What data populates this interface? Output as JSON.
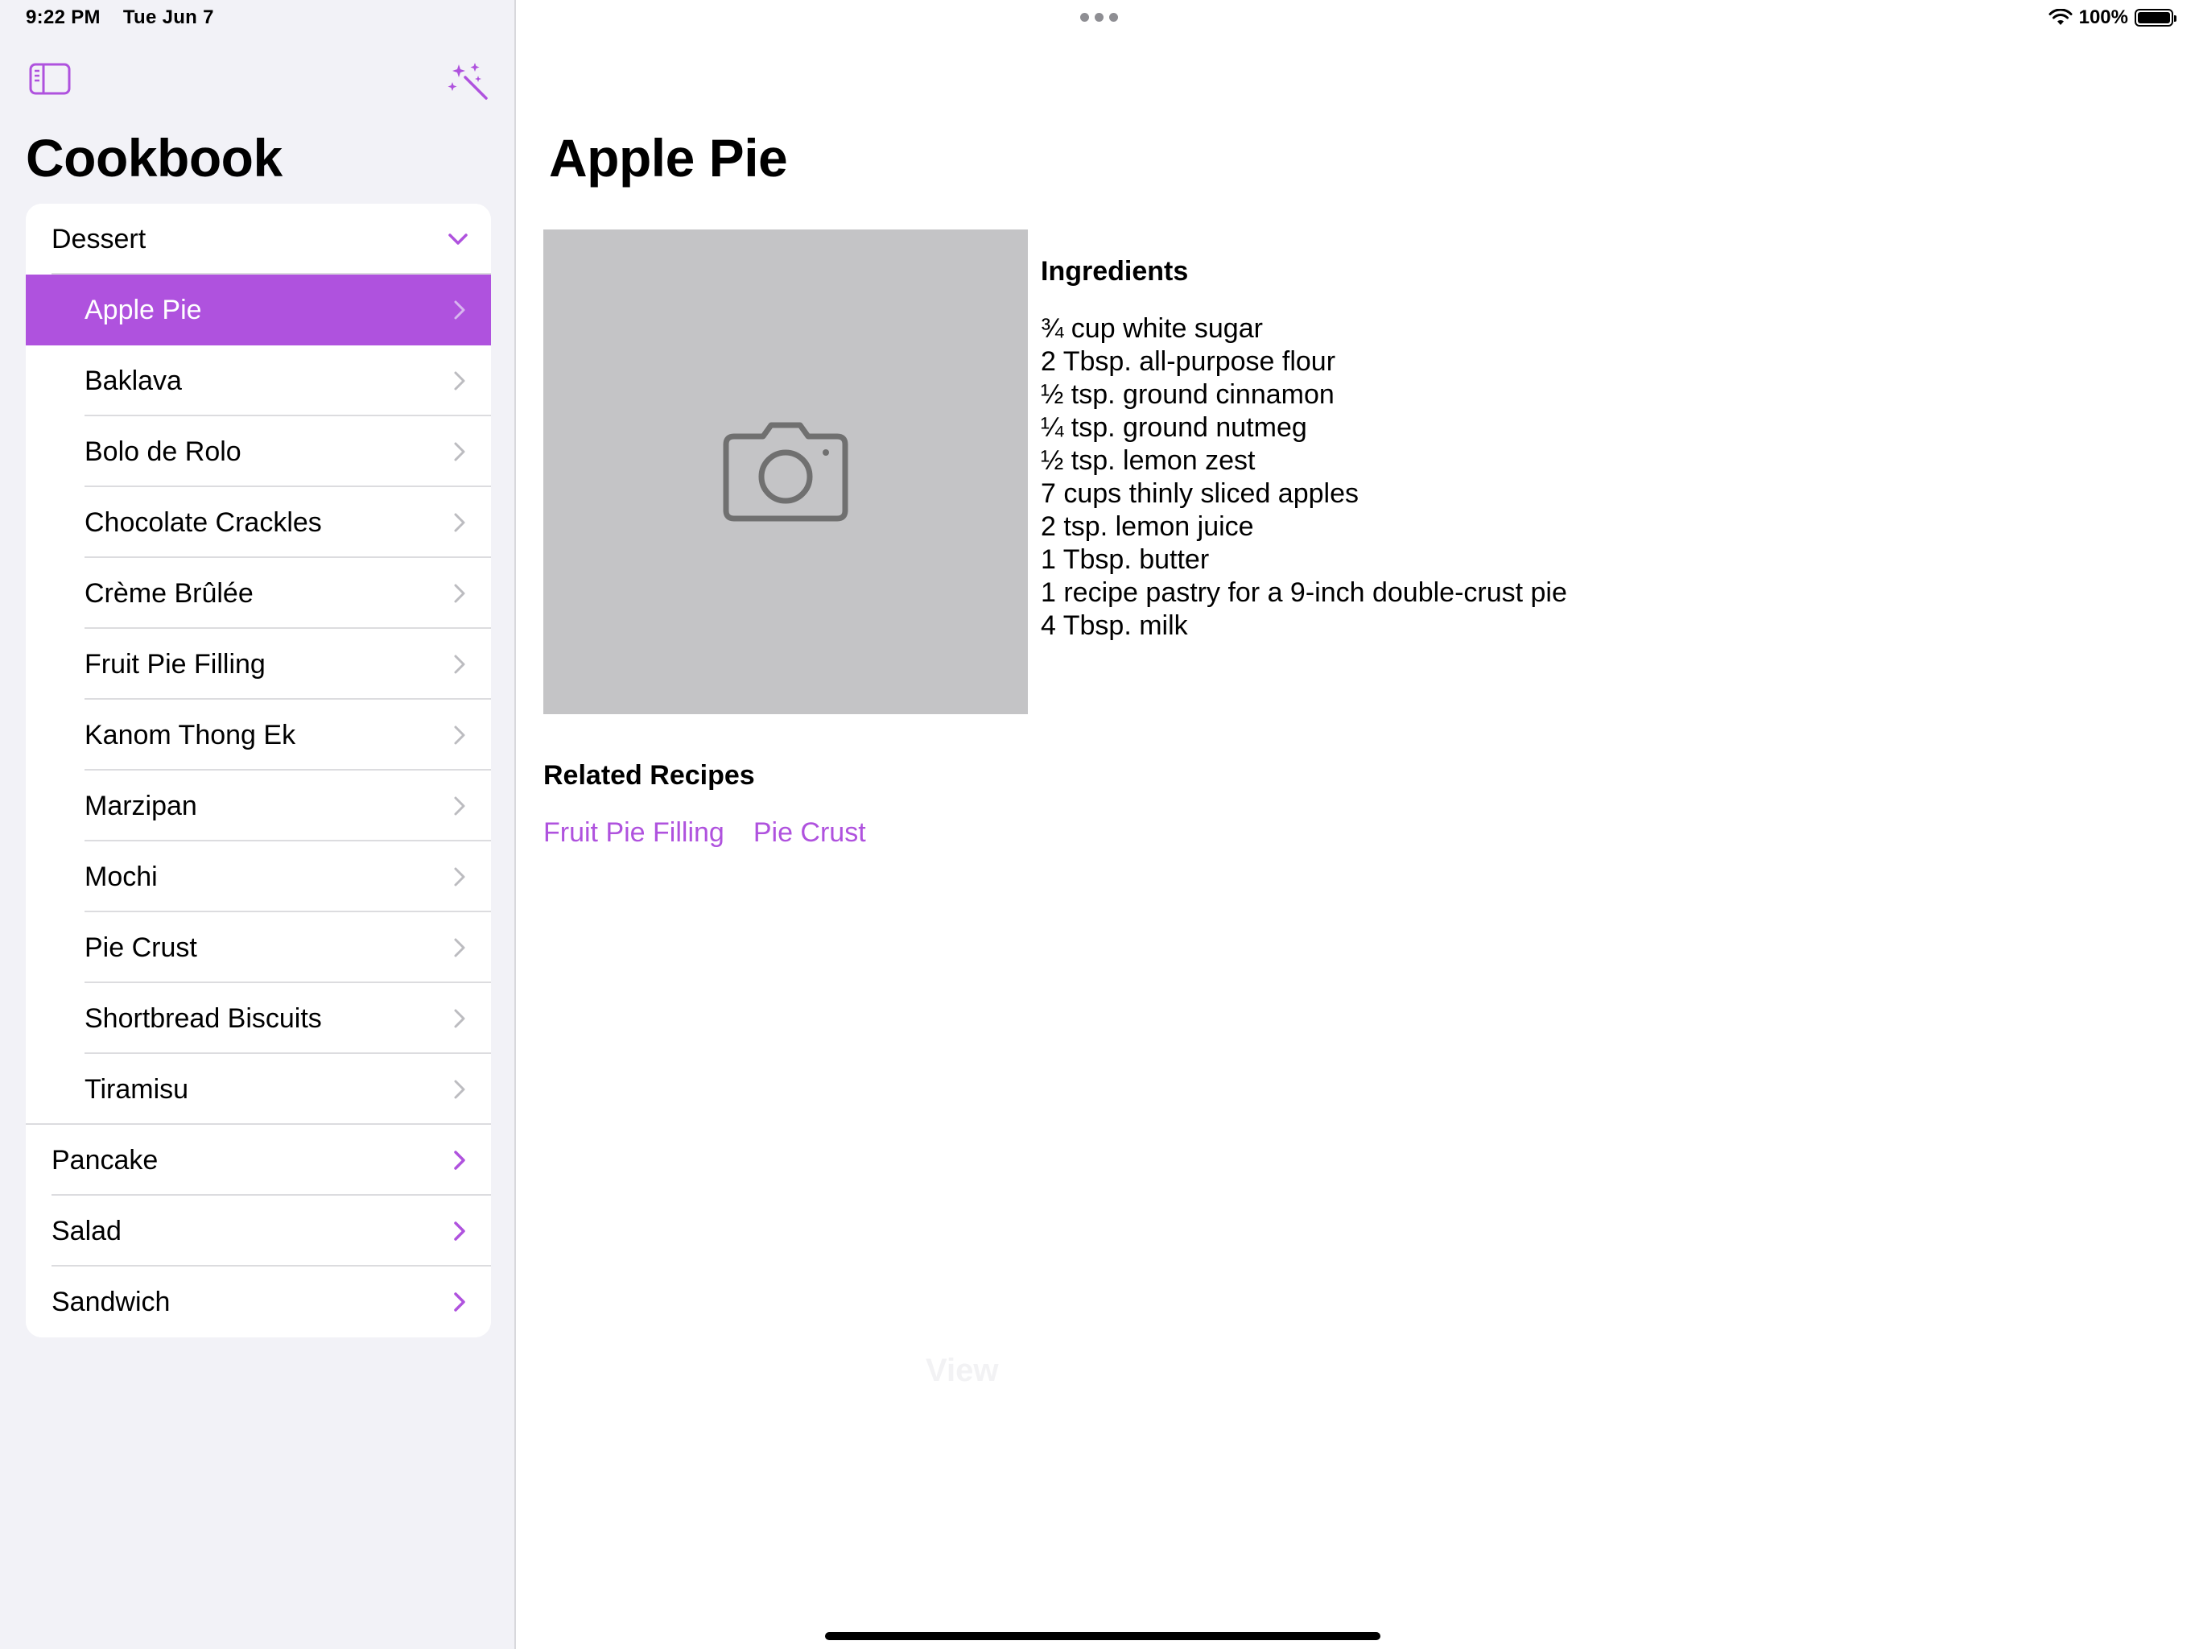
{
  "status_bar": {
    "time": "9:22 PM",
    "date": "Tue Jun 7",
    "battery": "100%"
  },
  "sidebar": {
    "title": "Cookbook",
    "groups": [
      {
        "label": "Dessert",
        "expanded": true,
        "items": [
          {
            "label": "Apple Pie",
            "selected": true
          },
          {
            "label": "Baklava"
          },
          {
            "label": "Bolo de Rolo"
          },
          {
            "label": "Chocolate Crackles"
          },
          {
            "label": "Crème Brûlée"
          },
          {
            "label": "Fruit Pie Filling"
          },
          {
            "label": "Kanom Thong Ek"
          },
          {
            "label": "Marzipan"
          },
          {
            "label": "Mochi"
          },
          {
            "label": "Pie Crust"
          },
          {
            "label": "Shortbread Biscuits"
          },
          {
            "label": "Tiramisu"
          }
        ]
      },
      {
        "label": "Pancake",
        "expanded": false
      },
      {
        "label": "Salad",
        "expanded": false
      },
      {
        "label": "Sandwich",
        "expanded": false
      }
    ]
  },
  "detail": {
    "title": "Apple Pie",
    "photo_icon": "camera-icon",
    "ingredients_heading": "Ingredients",
    "ingredients": [
      "¾ cup white sugar",
      "2 Tbsp. all-purpose flour",
      "½ tsp. ground cinnamon",
      "¼ tsp. ground nutmeg",
      "½ tsp. lemon zest",
      "7 cups thinly sliced apples",
      "2 tsp. lemon juice",
      "1 Tbsp. butter",
      "1 recipe pastry for a 9-inch double-crust pie",
      "4 Tbsp. milk"
    ],
    "related_heading": "Related Recipes",
    "related": [
      "Fruit Pie Filling",
      "Pie Crust"
    ]
  },
  "ghost_text": "View",
  "colors": {
    "accent": "#af52de",
    "sidebar_bg": "#f2f2f7",
    "photo_bg": "#c4c4c6",
    "icon_gray": "#707070"
  }
}
